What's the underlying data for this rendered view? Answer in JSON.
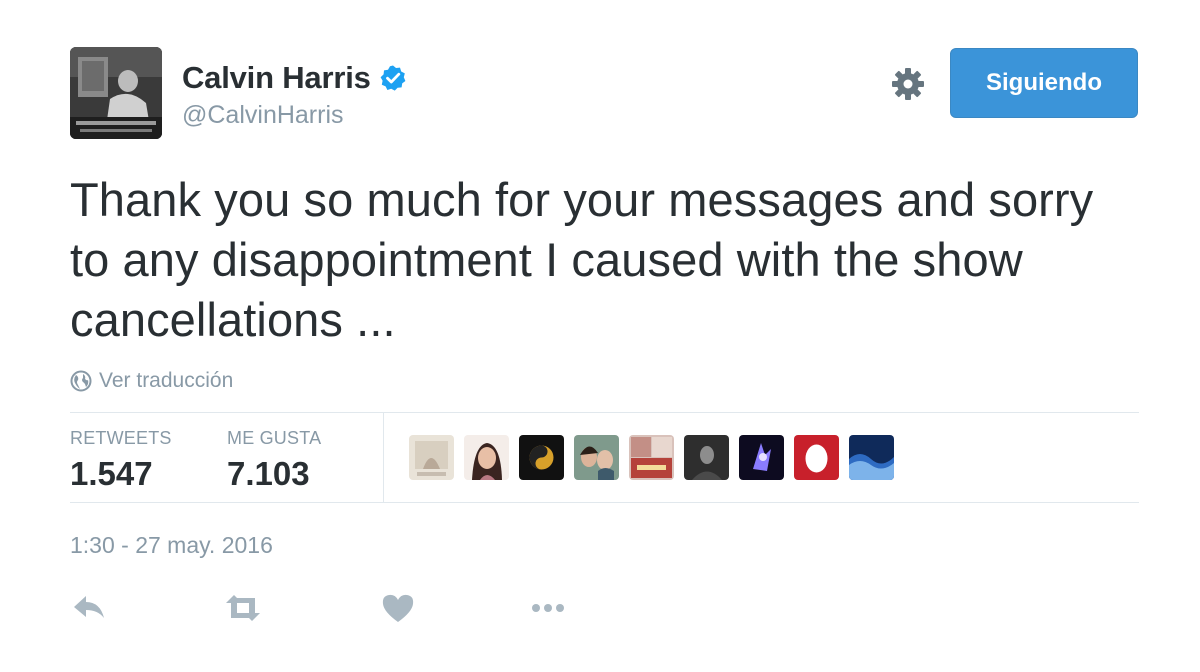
{
  "user": {
    "display_name": "Calvin Harris",
    "handle": "@CalvinHarris",
    "verified": true,
    "avatar": "avatar-photo"
  },
  "header": {
    "follow_button_label": "Siguiendo",
    "settings_icon": "gear-icon"
  },
  "tweet": {
    "text_lines": [
      "Thank you so much for your messages and sorry",
      "to any disappointment I caused with the show",
      "cancellations ..."
    ],
    "translate_label": "Ver traducción",
    "timestamp": "1:30 - 27 may. 2016"
  },
  "stats": {
    "retweets_label": "RETWEETS",
    "retweets_value": "1.547",
    "likes_label": "ME GUSTA",
    "likes_value": "7.103"
  },
  "likers": [
    {
      "icon": "liker-avatar-1"
    },
    {
      "icon": "liker-avatar-2"
    },
    {
      "icon": "liker-avatar-3"
    },
    {
      "icon": "liker-avatar-4"
    },
    {
      "icon": "liker-avatar-5"
    },
    {
      "icon": "liker-avatar-6"
    },
    {
      "icon": "liker-avatar-7"
    },
    {
      "icon": "liker-avatar-8"
    },
    {
      "icon": "liker-avatar-9"
    }
  ],
  "actions": [
    "reply-icon",
    "retweet-icon",
    "heart-icon",
    "more-icon"
  ],
  "colors": {
    "accent": "#3b94d9",
    "verified": "#1da1f2",
    "text": "#292f33",
    "muted": "#8899a6",
    "action_icon": "#aab8c2",
    "divider": "#e1e8ed"
  }
}
